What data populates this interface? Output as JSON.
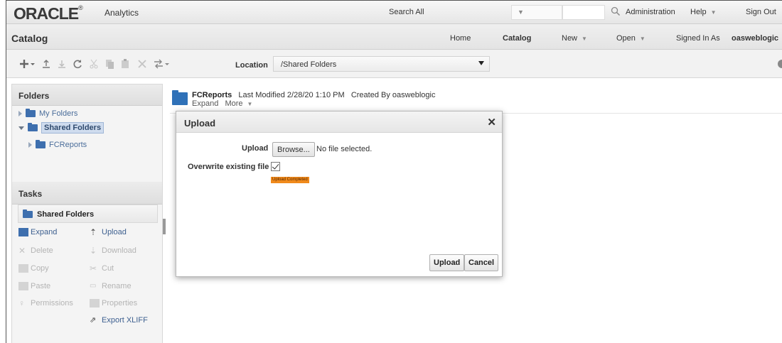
{
  "header": {
    "logo": "ORACLE",
    "product": "Analytics",
    "search_label": "Search",
    "search_scope": "All",
    "links": [
      "Administration",
      "Help",
      "Sign Out"
    ]
  },
  "catalog_bar": {
    "title": "Catalog",
    "home": "Home",
    "catalog": "Catalog",
    "new": "New",
    "open": "Open",
    "signed_in_as": "Signed In As",
    "user": "oasweblogic"
  },
  "toolbar": {
    "location_label": "Location",
    "location_value": "/Shared Folders"
  },
  "folders_panel": {
    "title": "Folders",
    "items": [
      "My Folders",
      "Shared Folders",
      "FCReports"
    ]
  },
  "tasks_panel": {
    "title": "Tasks",
    "folder": "Shared Folders",
    "left": [
      "Expand",
      "Delete",
      "Copy",
      "Paste",
      "Permissions"
    ],
    "right": [
      "Upload",
      "Download",
      "Cut",
      "Rename",
      "Properties",
      "Export XLIFF"
    ]
  },
  "content": {
    "folder_name": "FCReports",
    "last_modified_label": "Last Modified",
    "last_modified": "2/28/20 1:10 PM",
    "created_by_label": "Created By",
    "created_by": "oasweblogic",
    "expand": "Expand",
    "more": "More"
  },
  "dialog": {
    "title": "Upload",
    "upload_label": "Upload",
    "browse_label": "Browse...",
    "file_status": "No file selected.",
    "overwrite_label": "Overwrite existing file",
    "overwrite_checked": true,
    "status": "Upload Completed",
    "upload_button": "Upload",
    "cancel_button": "Cancel"
  },
  "colors": {
    "folder_blue": "#2f71b8",
    "status_orange": "#f08a1c",
    "link_blue": "#3d5f8f"
  }
}
